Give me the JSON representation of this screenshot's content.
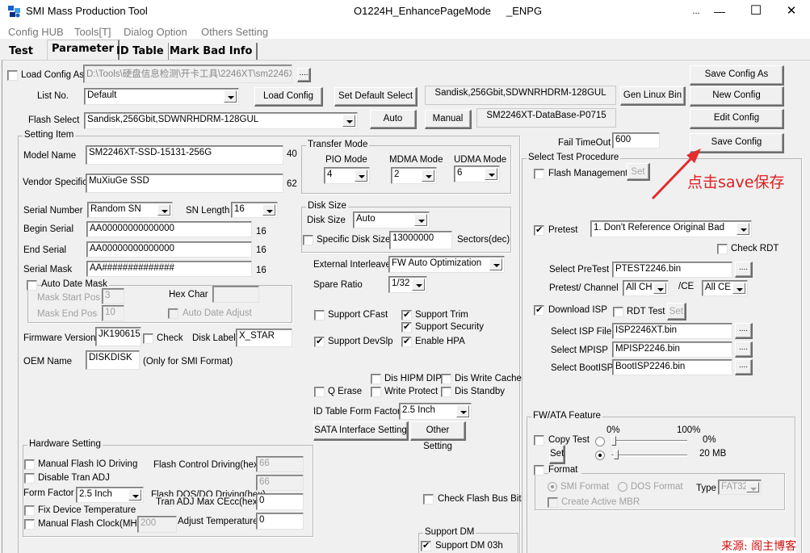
{
  "window": {
    "title": "SMI Mass Production Tool",
    "subtitle": "O1224H_EnhancePageMode",
    "subtitle2": "_ENPG",
    "more": "...",
    "minimize": "—",
    "maximize": "☐",
    "close": "✕"
  },
  "menu": [
    "Config HUB",
    "Tools[T]",
    "Dialog Option",
    "Others Setting"
  ],
  "tabs": [
    {
      "label": "Test",
      "active": false
    },
    {
      "label": "Parameter",
      "active": true
    },
    {
      "label": "ID Table",
      "active": false
    },
    {
      "label": "Mark Bad Info",
      "active": false
    }
  ],
  "config": {
    "load_config_as_label": "Load Config As",
    "load_config_as_checked": false,
    "load_config_path": "D:\\Tools\\硬盘信息检测\\开卡工具\\2246XT\\sm2246X",
    "browse": "....",
    "list_no_label": "List No.",
    "list_no_value": "Default",
    "load_config_btn": "Load Config",
    "set_default_select_btn": "Set Default Select",
    "flash_info_display": "Sandisk,256Gbit,SDWNRHDRM-128GUL",
    "gen_linux_bin_btn": "Gen Linux Bin",
    "flash_select_label": "Flash Select",
    "flash_select_value": "Sandisk,256Gbit,SDWNRHDRM-128GUL",
    "auto_btn": "Auto",
    "manual_btn": "Manual",
    "database_display": "SM2246XT-DataBase-P0715",
    "save_config_as_btn": "Save Config As",
    "new_config_btn": "New Config",
    "edit_config_btn": "Edit Config",
    "save_config_btn": "Save Config",
    "fail_timeout_label": "Fail TimeOut",
    "fail_timeout_value": "600"
  },
  "setting_item": {
    "caption": "Setting Item",
    "model_name_label": "Model Name",
    "model_name_value": "SM2246XT-SSD-15131-256G",
    "model_name_len": "40",
    "vendor_specific_label": "Vendor Specific",
    "vendor_specific_value": "MuXiuGe SSD",
    "vendor_specific_len": "62",
    "serial_number_label": "Serial Number",
    "serial_number_value": "Random SN",
    "sn_length_label": "SN Length",
    "sn_length_value": "16",
    "begin_serial_label": "Begin Serial",
    "begin_serial_value": "AA00000000000000",
    "begin_serial_len": "16",
    "end_serial_label": "End Serial",
    "end_serial_value": "AA00000000000000",
    "end_serial_len": "16",
    "serial_mask_label": "Serial Mask",
    "serial_mask_value": "AA##############",
    "serial_mask_len": "16",
    "auto_date_mask_label": "Auto Date Mask",
    "mask_start_pos_label": "Mask Start Pos",
    "mask_start_pos_value": "3",
    "mask_end_pos_label": "Mask End Pos",
    "mask_end_pos_value": "10",
    "hex_char_label": "Hex Char",
    "hex_char_value": "",
    "auto_date_adjust_label": "Auto Date Adjust",
    "firmware_version_label": "Firmware Version",
    "firmware_version_value": "JK190615",
    "check_label": "Check",
    "disk_label_label": "Disk Label",
    "disk_label_value": "X_STAR",
    "oem_name_label": "OEM Name",
    "oem_name_value": "DISKDISK",
    "oem_note": "(Only for SMI Format)"
  },
  "transfer_mode": {
    "caption": "Transfer Mode",
    "pio_label": "PIO Mode",
    "pio_value": "4",
    "mdma_label": "MDMA Mode",
    "mdma_value": "2",
    "udma_label": "UDMA Mode",
    "udma_value": "6"
  },
  "disk_size": {
    "caption": "Disk Size",
    "disk_size_label": "Disk Size",
    "disk_size_value": "Auto",
    "specific_label": "Specific Disk Size",
    "specific_value": "13000000",
    "unit": "Sectors(dec)"
  },
  "misc": {
    "external_interleave_label": "External Interleave",
    "external_interleave_value": "FW Auto Optimization",
    "spare_ratio_label": "Spare Ratio",
    "spare_ratio_value": "1/32",
    "support_cfast": "Support CFast",
    "support_trim": "Support Trim",
    "support_security": "Support Security",
    "support_devslp": "Support DevSlp",
    "enable_hpa": "Enable HPA",
    "dis_hipm_dipm": "Dis HIPM DIPM",
    "dis_write_cache": "Dis Write Cache",
    "q_erase": "Q Erase",
    "write_protect": "Write Protect",
    "dis_standby": "Dis Standby",
    "id_table_form_factor_label": "ID Table Form Factor",
    "id_table_form_factor_value": "2.5 Inch",
    "sata_interface_btn": "SATA Interface Setting",
    "other_setting_btn": "Other Setting",
    "check_flash_bus_bit": "Check Flash Bus Bit",
    "support_dm_caption": "Support DM",
    "support_dm_03h": "Support DM 03h"
  },
  "hardware": {
    "caption": "Hardware Setting",
    "manual_flash_io": "Manual Flash IO Driving",
    "disable_tran_adj": "Disable Tran ADJ",
    "form_factor_label": "Form Factor",
    "form_factor_value": "2.5 Inch",
    "fix_device_temp": "Fix Device Temperature",
    "manual_flash_clock": "Manual Flash Clock(MHz)",
    "manual_flash_clock_value": "200",
    "flash_control_driving_label": "Flash Control Driving(hex)",
    "flash_control_driving_value": "66",
    "flash_dqs_value": "66",
    "flash_dqs_label": "Flash DQS/DQ Driving(hex)",
    "tran_adj_label": "Tran ADJ Max CEcc(hex)",
    "tran_adj_value": "0",
    "adjust_temp_label": "Adjust Temperature",
    "adjust_temp_value": "0"
  },
  "test_procedure": {
    "caption": "Select Test Procedure",
    "flash_management": "Flash Management",
    "set": "Set",
    "pretest_label": "Pretest",
    "pretest_value": "1. Don't Reference Original Bad",
    "check_rdt": "Check RDT",
    "select_pretest_label": "Select PreTest",
    "select_pretest_value": "PTEST2246.bin",
    "pretest_channel_label": "Pretest/ Channel",
    "pretest_channel_value": "All CH",
    "ce_label": "/CE",
    "ce_value": "All CE",
    "download_isp": "Download ISP",
    "rdt_test": "RDT Test",
    "select_isp_label": "Select ISP File",
    "select_isp_value": "ISP2246XT.bin",
    "select_mpisp_label": "Select MPISP",
    "select_mpisp_value": "MPISP2246.bin",
    "select_bootisp_label": "Select BootISP",
    "select_bootisp_value": "BootISP2246.bin",
    "browse": "...."
  },
  "fw_ata": {
    "caption": "FW/ATA Feature",
    "pct_min": "0%",
    "pct_max": "100%",
    "copy_test": "Copy Test",
    "copy_pct_value": "0%",
    "copy_pct_fraction": 0.0,
    "copy_mb_value": "20 MB",
    "copy_mb_fraction": 0.03,
    "copy_mode_selected": "size",
    "set": "Set",
    "format": "Format",
    "smi_format": "SMI Format",
    "dos_format": "DOS Format",
    "type_label": "Type",
    "type_value": "FAT32",
    "create_active_mbr": "Create Active MBR"
  },
  "annotation": {
    "text": "点击save保存",
    "color": "#e02020"
  },
  "watermark": {
    "text": "来源: 阁主博客"
  }
}
